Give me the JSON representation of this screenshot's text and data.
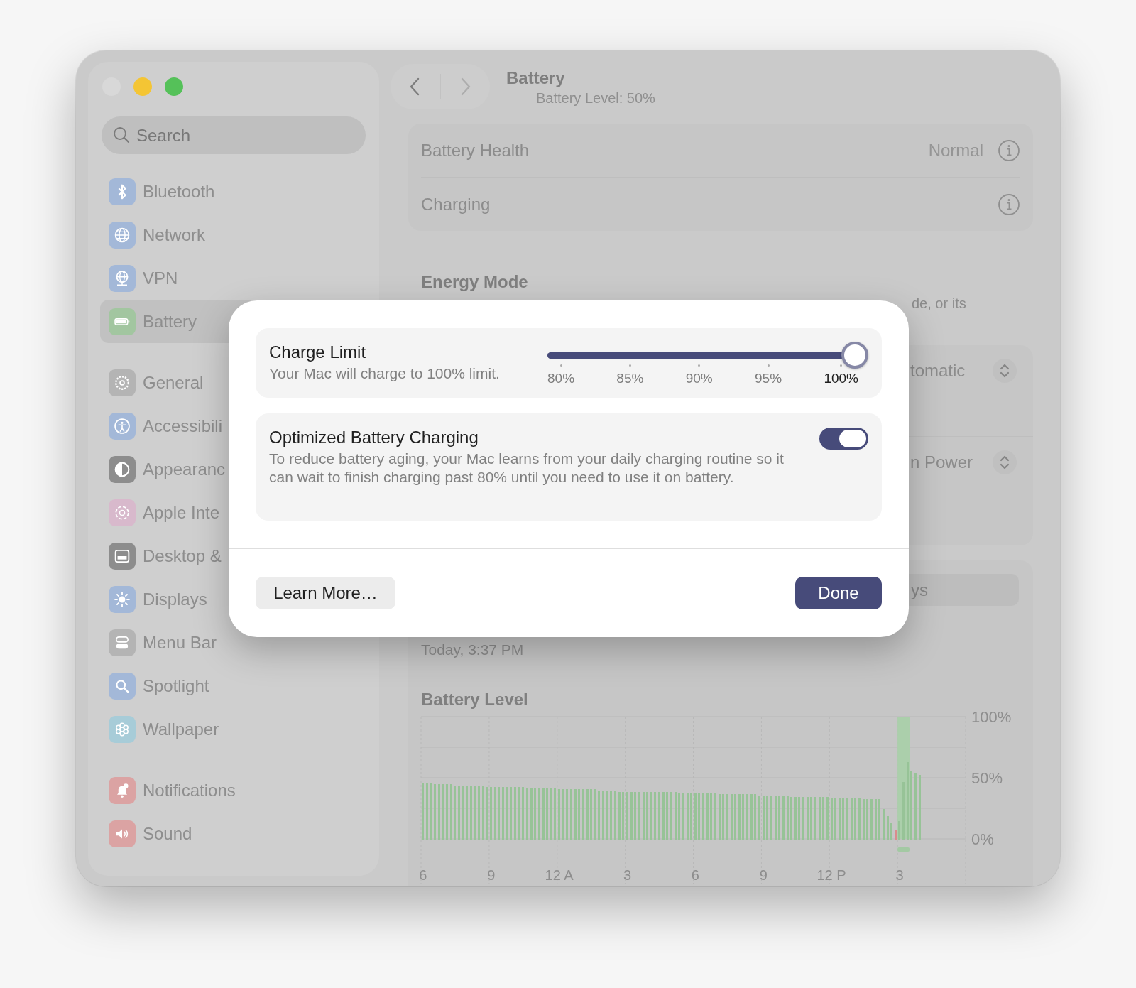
{
  "window": {
    "buttons": [
      {
        "color": "#d8d8d8"
      },
      {
        "color": "#f4c534"
      },
      {
        "color": "#55c159"
      }
    ]
  },
  "sidebar": {
    "search": {
      "placeholder": "Search"
    },
    "groups": [
      {
        "items": [
          {
            "label": "Bluetooth",
            "color": "#a3b8d8",
            "selected": false
          },
          {
            "label": "Network",
            "color": "#a3b8d8",
            "selected": false
          },
          {
            "label": "VPN",
            "color": "#a3b8d8",
            "selected": false
          },
          {
            "label": "Battery",
            "color": "#a2c6a0",
            "selected": true
          }
        ]
      },
      {
        "items": [
          {
            "label": "General",
            "color": "#b4b4b4",
            "selected": false
          },
          {
            "label": "Accessibili",
            "color": "#a3b8d8",
            "selected": false
          },
          {
            "label": "Appearanc",
            "color": "#8d8d8d",
            "selected": false
          },
          {
            "label": "Apple Inte",
            "color": "#d8b9cc",
            "selected": false
          },
          {
            "label": "Desktop &",
            "color": "#8d8d8d",
            "selected": false
          },
          {
            "label": "Displays",
            "color": "#a3b8d8",
            "selected": false
          },
          {
            "label": "Menu Bar",
            "color": "#b4b4b4",
            "selected": false
          },
          {
            "label": "Spotlight",
            "color": "#a3b8d8",
            "selected": false
          },
          {
            "label": "Wallpaper",
            "color": "#a7ccd8",
            "selected": false
          }
        ]
      },
      {
        "items": [
          {
            "label": "Notifications",
            "color": "#dba3a3",
            "selected": false
          },
          {
            "label": "Sound",
            "color": "#dba3a3",
            "selected": false
          }
        ]
      }
    ]
  },
  "header": {
    "title": "Battery",
    "subtitle": "Battery Level: 50%"
  },
  "health_card": {
    "rows": [
      {
        "label": "Battery Health",
        "value": "Normal"
      },
      {
        "label": "Charging"
      }
    ]
  },
  "energy_mode": {
    "heading": "Energy Mode",
    "description": "de, or its",
    "rows": [
      {
        "value": "tomatic"
      },
      {
        "value": "n Power"
      }
    ]
  },
  "usage": {
    "segment": "ys",
    "timestamp": "Today, 3:37 PM",
    "chart_data": {
      "type": "bar",
      "title": "Battery Level",
      "ylim": [
        0,
        100
      ],
      "yticks": [
        {
          "value": 0,
          "label": "0%"
        },
        {
          "value": 50,
          "label": "50%"
        },
        {
          "value": 100,
          "label": "100%"
        }
      ],
      "categories": [
        "6",
        null,
        null,
        null,
        null,
        null,
        null,
        null,
        null,
        null,
        null,
        null,
        null,
        null,
        null,
        null,
        null,
        "9",
        null,
        null,
        null,
        null,
        null,
        null,
        null,
        null,
        null,
        null,
        null,
        null,
        null,
        null,
        null,
        null,
        "12 A",
        null,
        null,
        null,
        null,
        null,
        null,
        null,
        null,
        null,
        null,
        null,
        null,
        null,
        null,
        null,
        null,
        "3",
        null,
        null,
        null,
        null,
        null,
        null,
        null,
        null,
        null,
        null,
        null,
        null,
        null,
        null,
        null,
        null,
        "6",
        null,
        null,
        null,
        null,
        null,
        null,
        null,
        null,
        null,
        null,
        null,
        null,
        null,
        null,
        null,
        null,
        "9",
        null,
        null,
        null,
        null,
        null,
        null,
        null,
        null,
        null,
        null,
        null,
        null,
        null,
        null,
        null,
        null,
        "12 P",
        null,
        null,
        null,
        null,
        null,
        null,
        null,
        null,
        null,
        null,
        null,
        null,
        null,
        null,
        null,
        null,
        "3",
        null,
        null,
        null,
        null,
        null,
        null,
        null,
        null,
        null,
        null,
        null,
        null,
        null,
        null,
        null,
        null
      ],
      "series": [
        {
          "color": "#97c397",
          "values": [
            45,
            45,
            45,
            44,
            44,
            44,
            44,
            44,
            43,
            43,
            43,
            43,
            43,
            43,
            43,
            43,
            42,
            42,
            42,
            42,
            42,
            42,
            42,
            42,
            42,
            42,
            41,
            41,
            41,
            41,
            41,
            41,
            41,
            41,
            40,
            40,
            40,
            40,
            40,
            40,
            40,
            40,
            40,
            40,
            39,
            39,
            39,
            39,
            39,
            38,
            38,
            38,
            38,
            38,
            38,
            38,
            38,
            38,
            38,
            38,
            38,
            38,
            38,
            38,
            37,
            37,
            37,
            37,
            37,
            37,
            37,
            37,
            37,
            37,
            36,
            36,
            36,
            36,
            36,
            36,
            36,
            36,
            36,
            36,
            35,
            35,
            35,
            35,
            35,
            35,
            35,
            35,
            34,
            34,
            34,
            34,
            34,
            34,
            34,
            34,
            34,
            34,
            33,
            33,
            33,
            33,
            33,
            33,
            33,
            33,
            32,
            32,
            32,
            32,
            32,
            24,
            18,
            13,
            null,
            14,
            46,
            62,
            55,
            53,
            52,
            null,
            null,
            null,
            null,
            null,
            null,
            null,
            null,
            null,
            null,
            null
          ]
        },
        {
          "color": "#d98c8c",
          "values": [
            null,
            null,
            null,
            null,
            null,
            null,
            null,
            null,
            null,
            null,
            null,
            null,
            null,
            null,
            null,
            null,
            null,
            null,
            null,
            null,
            null,
            null,
            null,
            null,
            null,
            null,
            null,
            null,
            null,
            null,
            null,
            null,
            null,
            null,
            null,
            null,
            null,
            null,
            null,
            null,
            null,
            null,
            null,
            null,
            null,
            null,
            null,
            null,
            null,
            null,
            null,
            null,
            null,
            null,
            null,
            null,
            null,
            null,
            null,
            null,
            null,
            null,
            null,
            null,
            null,
            null,
            null,
            null,
            null,
            null,
            null,
            null,
            null,
            null,
            null,
            null,
            null,
            null,
            null,
            null,
            null,
            null,
            null,
            null,
            null,
            null,
            null,
            null,
            null,
            null,
            null,
            null,
            null,
            null,
            null,
            null,
            null,
            null,
            null,
            null,
            null,
            null,
            null,
            null,
            null,
            null,
            null,
            null,
            null,
            null,
            null,
            null,
            null,
            null,
            null,
            null,
            null,
            null,
            7,
            null,
            null,
            null,
            null,
            null,
            null,
            null,
            null,
            null,
            null,
            null,
            null,
            null,
            null,
            null,
            null,
            null
          ]
        }
      ]
    }
  },
  "dialog": {
    "charge_limit": {
      "title": "Charge Limit",
      "description": "Your Mac will charge to 100% limit.",
      "level": 1,
      "ticks": [
        {
          "label": "80%",
          "selected": false
        },
        {
          "label": "85%",
          "selected": false
        },
        {
          "label": "90%",
          "selected": false
        },
        {
          "label": "95%",
          "selected": false
        },
        {
          "label": "100%",
          "selected": true
        }
      ]
    },
    "optimized": {
      "title": "Optimized Battery Charging",
      "description": "To reduce battery aging, your Mac learns from your daily charging routine so it can wait to finish charging past 80% until you need to use it on battery.",
      "on": true
    },
    "buttons": [
      {
        "label": "Learn More…",
        "kind": "secondary"
      },
      {
        "label": "Done",
        "kind": "primary"
      }
    ]
  }
}
